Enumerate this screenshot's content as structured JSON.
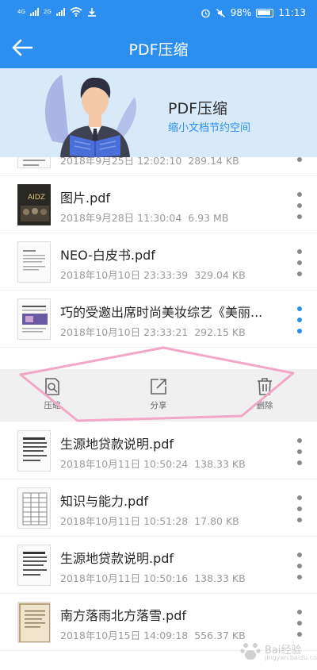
{
  "status_bar": {
    "net_label_1": "4G",
    "net_label_2": "2G",
    "battery": "98%",
    "time": "11:13"
  },
  "header": {
    "title": "PDF压缩",
    "back_icon": "arrow-left-icon"
  },
  "banner": {
    "title": "PDF压缩",
    "subtitle": "缩小文档节约空间"
  },
  "files": [
    {
      "name": "",
      "date": "2018年9月25日 12:02:10",
      "size": "289.14 KB",
      "thumb": "doc-light"
    },
    {
      "name": "图片.pdf",
      "date": "2018年9月28日 11:30:04",
      "size": "6.93 MB",
      "thumb": "photo-dark"
    },
    {
      "name": "NEO-白皮书.pdf",
      "date": "2018年10月10日 23:33:39",
      "size": "329.04 KB",
      "thumb": "doc-light"
    },
    {
      "name": "巧的受邀出席时尚美妆综艺《美丽...",
      "date": "2018年10月10日 23:33:21",
      "size": "292.15 KB",
      "thumb": "doc-image"
    },
    {
      "name": "生源地贷款说明.pdf",
      "date": "2018年10月11日 10:50:24",
      "size": "138.33 KB",
      "thumb": "doc-heavy"
    },
    {
      "name": "知识与能力.pdf",
      "date": "2018年10月11日 10:51:28",
      "size": "17.80 KB",
      "thumb": "doc-table"
    },
    {
      "name": "生源地贷款说明.pdf",
      "date": "2018年10月11日 10:50:16",
      "size": "138.33 KB",
      "thumb": "doc-heavy"
    },
    {
      "name": "南方落雨北方落雪.pdf",
      "date": "2018年10月15日 14:09:18",
      "size": "556.37 KB",
      "thumb": "doc-parchment"
    }
  ],
  "actions": {
    "compress": "压缩",
    "share": "分享",
    "delete": "删除"
  },
  "watermark": {
    "text": "Bai经验",
    "url": "jingyan.baidu.com"
  },
  "colors": {
    "primary": "#2c8ff0",
    "banner_bg": "#d8e9f7",
    "annotation": "#f2a7c8"
  }
}
